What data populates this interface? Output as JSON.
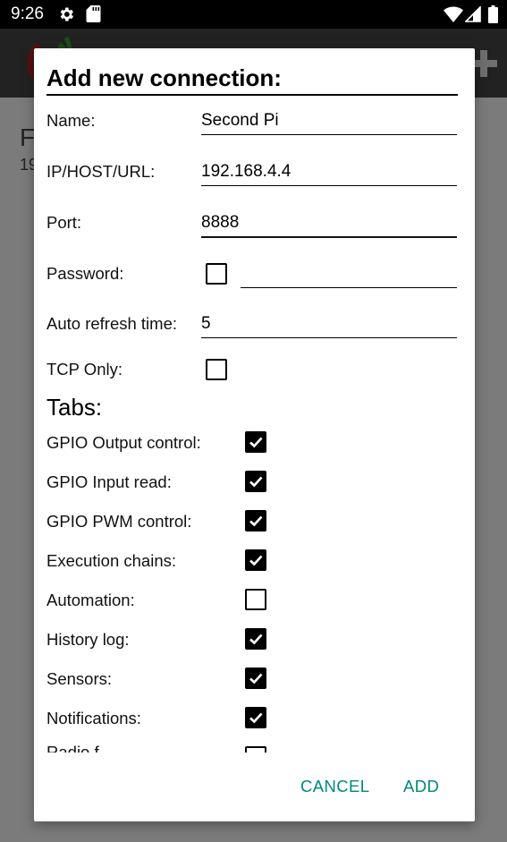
{
  "status_bar": {
    "time": "9:26",
    "icons": [
      "gear-icon",
      "sd-card-icon",
      "wifi-icon",
      "signal-icon",
      "battery-icon"
    ]
  },
  "background": {
    "line1": "F",
    "line2": "19"
  },
  "dialog": {
    "title": "Add new connection:",
    "fields": {
      "name": {
        "label": "Name:",
        "value": "Second Pi"
      },
      "host": {
        "label": "IP/HOST/URL:",
        "value": "192.168.4.4"
      },
      "port": {
        "label": "Port:",
        "value": "8888"
      },
      "password": {
        "label": "Password:",
        "checked": false,
        "value": ""
      },
      "refresh": {
        "label": "Auto refresh time:",
        "value": "5"
      },
      "tcp": {
        "label": "TCP Only:",
        "checked": false
      }
    },
    "tabs_title": "Tabs:",
    "tabs": [
      {
        "label": "GPIO Output control:",
        "checked": true
      },
      {
        "label": "GPIO Input read:",
        "checked": true
      },
      {
        "label": "GPIO PWM control:",
        "checked": true
      },
      {
        "label": "Execution chains:",
        "checked": true
      },
      {
        "label": "Automation:",
        "checked": false
      },
      {
        "label": "History log:",
        "checked": true
      },
      {
        "label": "Sensors:",
        "checked": true
      },
      {
        "label": "Notifications:",
        "checked": true
      }
    ],
    "cutoff_label": "Radio f",
    "cancel_label": "CANCEL",
    "add_label": "ADD"
  },
  "colors": {
    "accent": "#00897b",
    "scrim": "#7b7b7b",
    "app_bar": "#222222"
  }
}
